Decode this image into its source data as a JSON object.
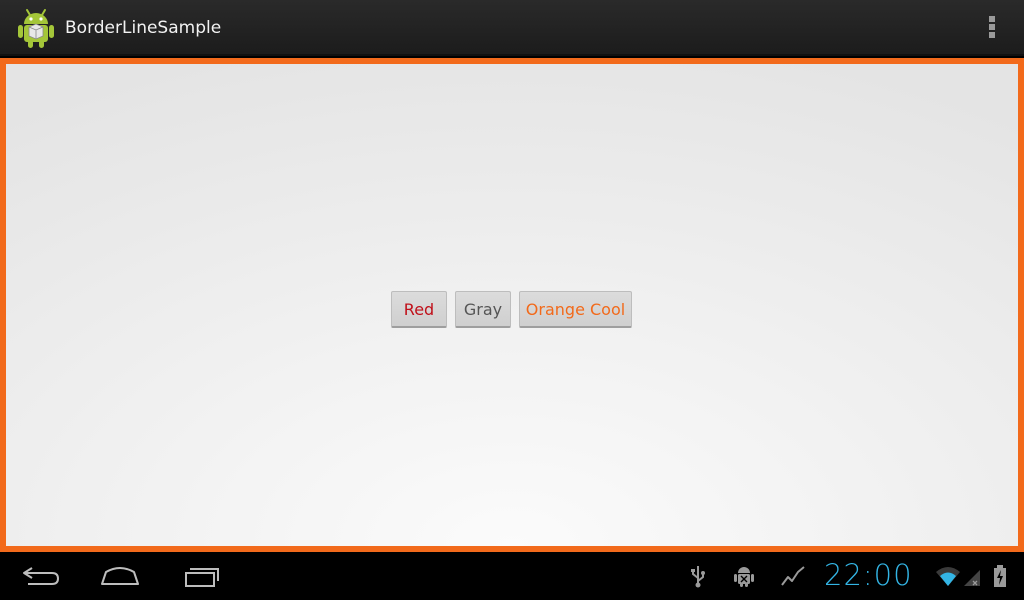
{
  "app": {
    "title": "BorderLineSample",
    "icon": "android-robot-icon"
  },
  "theme": {
    "border_color": "#f26a1b",
    "action_bar_bg": "#222222",
    "content_bg": "#eeeeee"
  },
  "buttons": [
    {
      "label": "Red",
      "text_color": "#c0101a"
    },
    {
      "label": "Gray",
      "text_color": "#555555"
    },
    {
      "label": "Orange Cool",
      "text_color": "#f26a1b"
    }
  ],
  "navigation": {
    "back_icon": "back-icon",
    "home_icon": "home-icon",
    "recents_icon": "recent-apps-icon"
  },
  "status": {
    "time": "22:00",
    "time_color": "#33b5e5",
    "icons": [
      "usb-icon",
      "android-debug-icon",
      "activity-graph-icon",
      "wifi-icon",
      "signal-icon",
      "battery-charging-icon"
    ]
  }
}
